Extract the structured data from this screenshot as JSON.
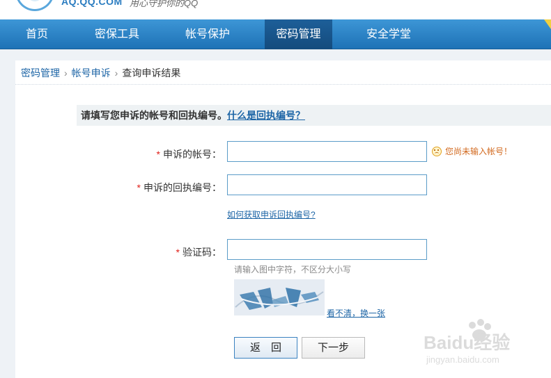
{
  "header": {
    "logo_text": "AQ.QQ.COM",
    "slogan": "用心守护你的QQ"
  },
  "nav": {
    "items": [
      {
        "label": "首页"
      },
      {
        "label": "密保工具"
      },
      {
        "label": "帐号保护"
      },
      {
        "label": "密码管理"
      },
      {
        "label": "安全学堂"
      }
    ],
    "active": "密码管理"
  },
  "breadcrumb": {
    "items": [
      "密码管理",
      "帐号申诉",
      "查询申诉结果"
    ]
  },
  "form": {
    "notice_text": "请填写您申诉的帐号和回执编号。",
    "notice_link": "什么是回执编号？",
    "required_mark": "*",
    "account_label": "申诉的帐号：",
    "account_value": "",
    "account_warning": "您尚未输入帐号！",
    "receipt_label": "申诉的回执编号：",
    "receipt_value": "",
    "receipt_help_link": "如何获取申诉回执编号?",
    "captcha_label": "验证码：",
    "captcha_value": "",
    "captcha_hint": "请输入图中字符，不区分大小写",
    "captcha_refresh": "看不清，换一张",
    "back_button": "返　回",
    "next_button": "下一步"
  },
  "watermark": {
    "brand": "Baidu经验",
    "url": "jingyan.baidu.com"
  },
  "colors": {
    "nav_blue": "#2a84c8",
    "nav_active": "#1a5a92",
    "link": "#1d65a6",
    "required": "#e0201a",
    "warning": "#d2691e",
    "input_border": "#5b9cc8"
  }
}
